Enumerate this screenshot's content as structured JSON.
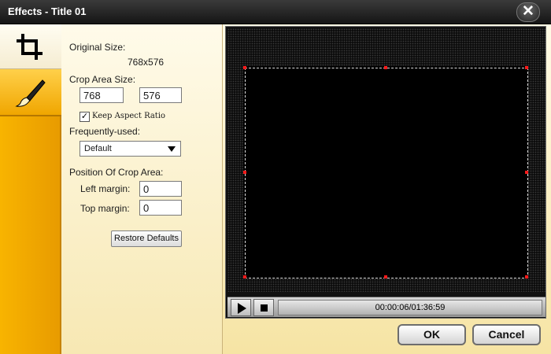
{
  "window": {
    "title": "Effects - Title 01",
    "close_glyph": "✕"
  },
  "sidebar": {
    "tabs": [
      {
        "name": "crop",
        "icon": "crop-icon"
      },
      {
        "name": "effect",
        "icon": "brush-icon"
      }
    ]
  },
  "crop_panel": {
    "original_size_label": "Original Size:",
    "original_size_value": "768x576",
    "crop_area_size_label": "Crop Area Size:",
    "crop_width": "768",
    "crop_height": "576",
    "keep_aspect_ratio_label": "Keep Aspect Ratio",
    "keep_aspect_ratio_checked": true,
    "frequently_used_label": "Frequently-used:",
    "frequently_used_value": "Default",
    "position_label": "Position Of Crop Area:",
    "left_margin_label": "Left margin:",
    "left_margin_value": "0",
    "top_margin_label": "Top margin:",
    "top_margin_value": "0",
    "restore_defaults_label": "Restore Defaults"
  },
  "player": {
    "timecode": "00:00:06/01:36:59"
  },
  "footer": {
    "ok_label": "OK",
    "cancel_label": "Cancel"
  },
  "colors": {
    "accent": "#f5a800",
    "crop_handle": "#ff1a1a"
  }
}
